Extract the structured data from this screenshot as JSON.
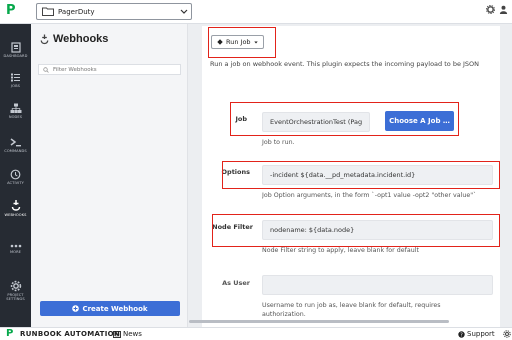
{
  "topbar": {
    "logo": "P",
    "project": "PagerDuty"
  },
  "leftnav": {
    "items": [
      {
        "label": "DASHBOARD",
        "icon": "dashboard-icon"
      },
      {
        "label": "JOBS",
        "icon": "jobs-icon"
      },
      {
        "label": "NODES",
        "icon": "nodes-icon"
      },
      {
        "label": "COMMANDS",
        "icon": "commands-icon"
      },
      {
        "label": "ACTIVITY",
        "icon": "activity-icon"
      },
      {
        "label": "WEBHOOKS",
        "icon": "webhooks-icon"
      },
      {
        "label": "MORE",
        "icon": "more-icon"
      },
      {
        "label": "PROJECT SETTINGS",
        "icon": "gear-icon"
      }
    ]
  },
  "webhooks_panel": {
    "title": "Webhooks",
    "filter_placeholder": "Filter Webhooks",
    "create_button": "Create Webhook"
  },
  "main": {
    "run_job_button": "Run Job",
    "description": "Run a job on webhook event. This plugin expects the incoming payload to be JSON",
    "job": {
      "label": "Job",
      "value": "EventOrchestrationTest (Pag",
      "choose_button": "Choose A Job …",
      "help": "Job to run."
    },
    "options": {
      "label": "Options",
      "value": "-incident ${data.__pd_metadata.incident.id}",
      "help": "Job Option arguments, in the form `-opt1 value -opt2 \"other value\"`"
    },
    "node_filter": {
      "label": "Node Filter",
      "value": "nodename: ${data.node}",
      "help": "Node Filter string to apply, leave blank for default"
    },
    "as_user": {
      "label": "As User",
      "value": "",
      "help": "Username to run job as, leave blank for default, requires authorization."
    }
  },
  "bottombar": {
    "logo": "P",
    "title": "RUNBOOK AUTOMATION",
    "news": "News",
    "support": "Support"
  },
  "colors": {
    "brand_green": "#06a84b",
    "primary_blue": "#3c6ed6",
    "nav_dark": "#262b33",
    "highlight_red": "#e2231a"
  }
}
